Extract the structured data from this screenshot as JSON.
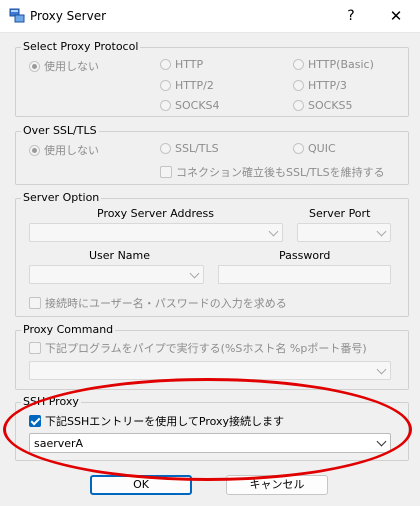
{
  "window": {
    "title": "Proxy Server",
    "help_glyph": "?",
    "close_glyph": "✕"
  },
  "protocol": {
    "title": "Select Proxy Protocol",
    "options": [
      "使用しない",
      "HTTP",
      "HTTP(Basic)",
      "HTTP/2",
      "HTTP/3",
      "SOCKS4",
      "SOCKS5"
    ],
    "selected": "使用しない"
  },
  "ssl": {
    "title": "Over SSL/TLS",
    "options": [
      "使用しない",
      "SSL/TLS",
      "QUIC"
    ],
    "selected": "使用しない",
    "keep_ssl_label": "コネクション確立後もSSL/TLSを維持する"
  },
  "server": {
    "title": "Server Option",
    "address_label": "Proxy Server Address",
    "port_label": "Server Port",
    "user_label": "User Name",
    "password_label": "Password",
    "prompt_label": "接続時にユーザー名・パスワードの入力を求める"
  },
  "command": {
    "title": "Proxy Command",
    "pipe_label": "下記プログラムをパイプで実行する(%Sホスト名 %pポート番号)"
  },
  "ssh": {
    "title": "SSH Proxy",
    "use_label": "下記SSHエントリーを使用してProxy接続します",
    "use_checked": true,
    "entry_value": "saerverA"
  },
  "buttons": {
    "ok": "OK",
    "cancel": "キャンセル"
  },
  "annotation_color": "#e00000"
}
